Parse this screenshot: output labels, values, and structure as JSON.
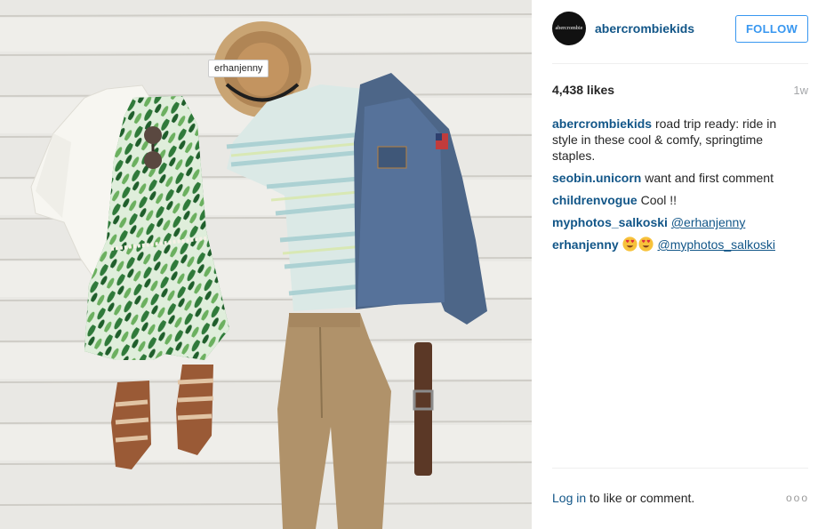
{
  "photo": {
    "tag_label": "erhanjenny"
  },
  "header": {
    "avatar_text": "abercrombie",
    "username": "abercrombiekids",
    "follow_label": "FOLLOW"
  },
  "stats": {
    "likes": "4,438 likes",
    "time_ago": "1w"
  },
  "comments": [
    {
      "user": "abercrombiekids",
      "text": "road trip ready: ride in style in these cool & comfy, springtime staples."
    },
    {
      "user": "seobin.unicorn",
      "text": "want and first comment"
    },
    {
      "user": "childrenvogue",
      "text": "Cool !!"
    },
    {
      "user": "myphotos_salkoski",
      "mention": "@erhanjenny"
    },
    {
      "user": "erhanjenny",
      "emoji": [
        "heart-eyes-emoji",
        "heart-eyes-emoji"
      ],
      "mention": "@myphotos_salkoski"
    }
  ],
  "footer": {
    "login_link": "Log in",
    "login_text": "to like or comment.",
    "more_label": "ooo"
  },
  "colors": {
    "link": "#125688",
    "follow_blue": "#3897f0",
    "muted": "#a5a7aa"
  }
}
